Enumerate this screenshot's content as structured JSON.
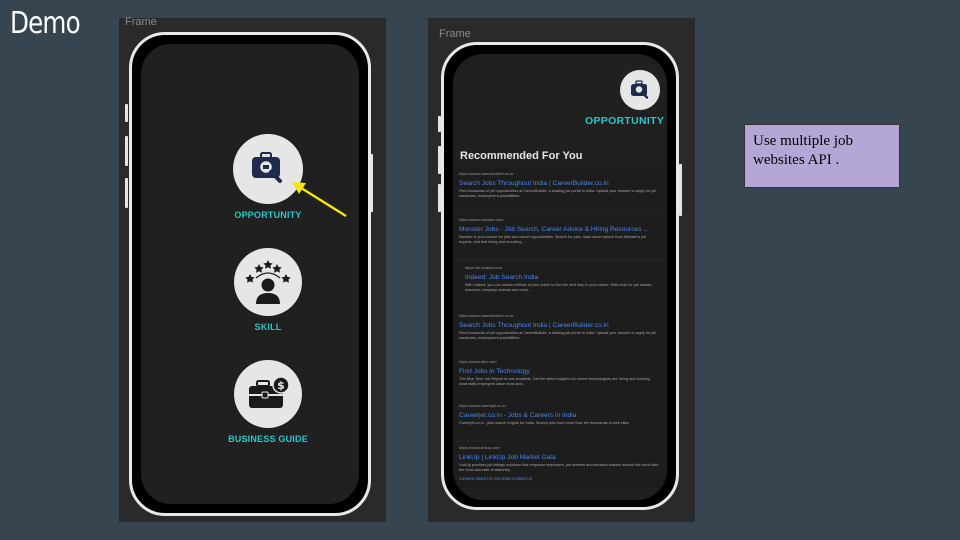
{
  "slide": {
    "title": "Demo"
  },
  "left_frame": {
    "label": "Frame",
    "menu": [
      {
        "label": "OPPORTUNITY",
        "icon": "briefcase-search-icon"
      },
      {
        "label": "SKILL",
        "icon": "person-stars-icon"
      },
      {
        "label": "BUSINESS GUIDE",
        "icon": "briefcase-dollar-icon"
      }
    ]
  },
  "right_frame": {
    "label": "Frame",
    "header": {
      "label": "OPPORTUNITY",
      "icon": "briefcase-search-icon"
    },
    "section_title": "Recommended For You",
    "results": [
      {
        "url": "https://www.careerbuilder.co.in",
        "title": "Search Jobs Throughout India | CareerBuilder.co.in",
        "snippet": "Find thousands of job opportunities at CareerBuilder, a leading job portal in India. Upload your resume to apply for job vacancies, employment possibilities."
      },
      {
        "url": "https://www.monster.com",
        "title": "Monster Jobs - Job Search, Career Advice & Hiring Resources ...",
        "snippet": "Monster is your source for jobs and career opportunities. Search for jobs, read career advice from Monster's job experts, and find hiring and recruiting ..."
      },
      {
        "url": "https://in.indeed.com",
        "title": "Indeed: Job Search India",
        "snippet": "With Indeed, you can search millions of jobs online to find the next step in your career. With tools for job search, resumes, company reviews and more..."
      },
      {
        "url": "https://www.careerbuilder.co.in",
        "title": "Search Jobs Throughout India | CareerBuilder.co.in",
        "snippet": "Find thousands of job opportunities at CareerBuilder, a leading job portal in India. Upload your resume to apply for job vacancies, employment possibilities."
      },
      {
        "url": "https://www.dice.com",
        "title": "Find Jobs in Technology",
        "snippet": "The Dice Tech Job Report is now available. Get the latest insights into where technologists are hiring and working, what skills employers value most and..."
      },
      {
        "url": "https://www.careerjet.co.in",
        "title": "Careerjet.co.in - Jobs & Careers in India",
        "snippet": "Careerjet.co.in - jobs search engine for India. Search jobs from more than ten thousands of web sites."
      },
      {
        "url": "https://www.linkup.com",
        "title": "LinkUp | LinkUp Job Market Data",
        "snippet": "LinkUp provides job listings solutions that empower employers, job seekers and decision-makers around the world with the most accurate, trustworthy,",
        "links": "Careers   About Us   Our Data   Contact Us"
      }
    ]
  },
  "note": {
    "text": "Use multiple job websites API ."
  },
  "colors": {
    "accent": "#29c7c7",
    "link": "#4a86e8",
    "note_bg": "#b4a7d6",
    "arrow": "#f5e612"
  }
}
